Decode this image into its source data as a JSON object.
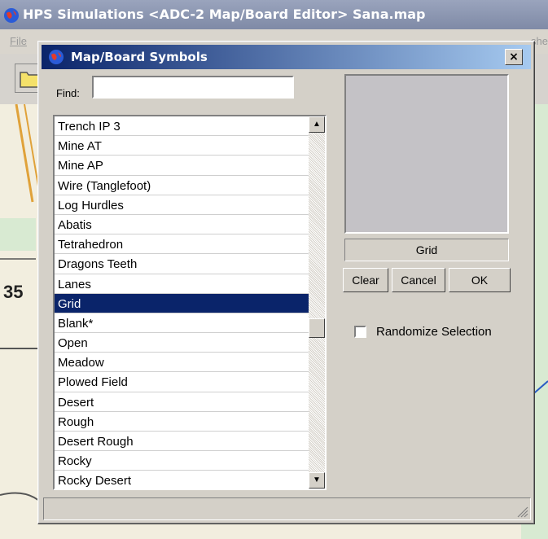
{
  "app": {
    "title": "HPS Simulations  <ADC-2 Map/Board Editor>  Sana.map",
    "menu": {
      "file": "File",
      "partial_right": "she"
    },
    "map_label": "35"
  },
  "dialog": {
    "title": "Map/Board Symbols",
    "close_label": "×",
    "find_label": "Find:",
    "find_value": "",
    "list_items": [
      "Trench IP 3",
      "Mine AT",
      "Mine AP",
      "Wire (Tanglefoot)",
      "Log Hurdles",
      "Abatis",
      "Tetrahedron",
      "Dragons Teeth",
      "Lanes",
      "Grid",
      " Blank*",
      "Open",
      "Meadow",
      "Plowed Field",
      "Desert",
      "Rough",
      "Desert Rough",
      "Rocky",
      "Rocky Desert"
    ],
    "selected_item": "Grid",
    "preview_name": "Grid",
    "buttons": {
      "clear": "Clear",
      "cancel": "Cancel",
      "ok": "OK"
    },
    "randomize_label": "Randomize Selection",
    "randomize_checked": false
  },
  "colors": {
    "selection": "#0a246a",
    "dialog_face": "#d4d0c8",
    "map_background": "#f2eedf"
  }
}
